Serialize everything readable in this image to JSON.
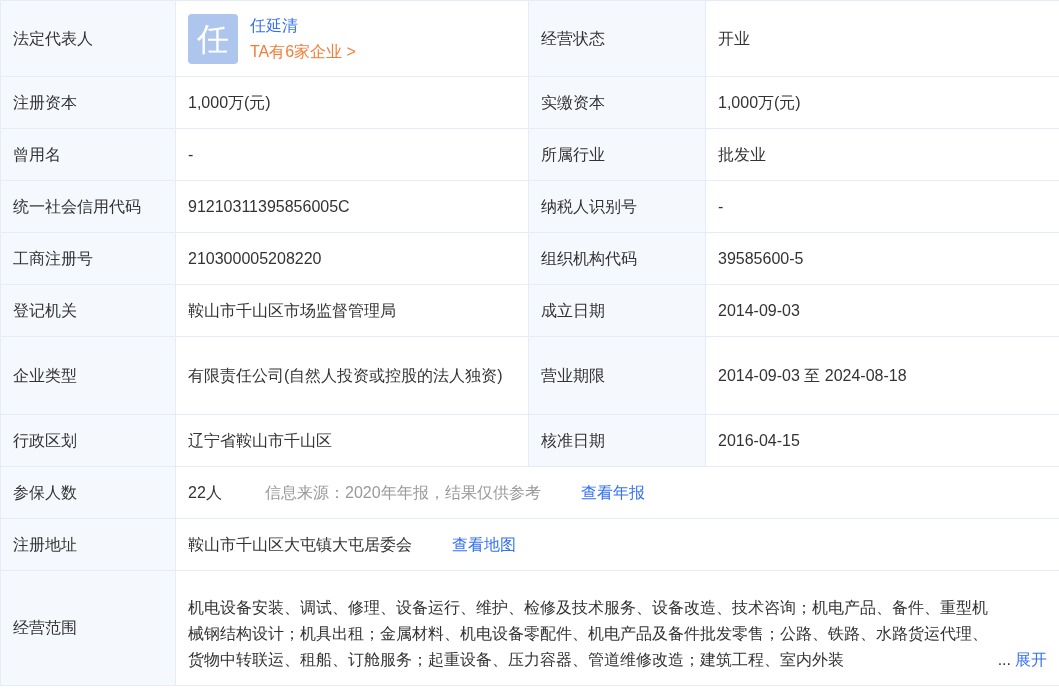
{
  "rows": [
    {
      "kind": "pair",
      "cells": [
        {
          "label": "法定代表人",
          "person": {
            "avatar": "任",
            "name": "任延清",
            "link": "TA有6家企业 >"
          }
        },
        {
          "label": "经营状态",
          "value": "开业"
        }
      ]
    },
    {
      "kind": "pair",
      "cells": [
        {
          "label": "注册资本",
          "value": "1,000万(元)"
        },
        {
          "label": "实缴资本",
          "value": "1,000万(元)"
        }
      ]
    },
    {
      "kind": "pair",
      "cells": [
        {
          "label": "曾用名",
          "value": "-"
        },
        {
          "label": "所属行业",
          "value": "批发业"
        }
      ]
    },
    {
      "kind": "pair",
      "cells": [
        {
          "label": "统一社会信用代码",
          "value": "91210311395856005C"
        },
        {
          "label": "纳税人识别号",
          "value": "-"
        }
      ]
    },
    {
      "kind": "pair",
      "cells": [
        {
          "label": "工商注册号",
          "value": "210300005208220"
        },
        {
          "label": "组织机构代码",
          "value": "39585600-5"
        }
      ]
    },
    {
      "kind": "pair",
      "cells": [
        {
          "label": "登记机关",
          "value": "鞍山市千山区市场监督管理局"
        },
        {
          "label": "成立日期",
          "value": "2014-09-03"
        }
      ]
    },
    {
      "kind": "pair",
      "cells": [
        {
          "label": "企业类型",
          "value": "有限责任公司(自然人投资或控股的法人独资)"
        },
        {
          "label": "营业期限",
          "value": "2014-09-03 至 2024-08-18"
        }
      ]
    },
    {
      "kind": "pair",
      "cells": [
        {
          "label": "行政区划",
          "value": "辽宁省鞍山市千山区"
        },
        {
          "label": "核准日期",
          "value": "2016-04-15"
        }
      ]
    },
    {
      "kind": "wide",
      "label": "参保人数",
      "value": "22人",
      "note": "信息来源：2020年年报，结果仅供参考",
      "link": "查看年报"
    },
    {
      "kind": "wide",
      "label": "注册地址",
      "value": "鞍山市千山区大屯镇大屯居委会",
      "link": "查看地图"
    },
    {
      "kind": "scope",
      "label": "经营范围",
      "value": "机电设备安装、调试、修理、设备运行、维护、检修及技术服务、设备改造、技术咨询；机电产品、备件、重型机械钢结构设计；机具出租；金属材料、机电设备零配件、机电产品及备件批发零售；公路、铁路、水路货运代理、货物中转联运、租船、订舱服务；起重设备、压力容器、管道维修改造；建筑工程、室内外装",
      "ellipsis": "...",
      "link": "展开"
    }
  ]
}
